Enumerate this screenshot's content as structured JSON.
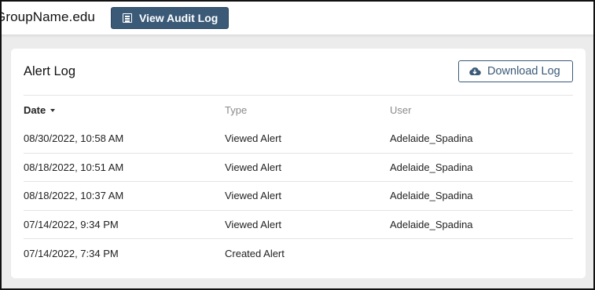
{
  "header": {
    "org_name": "GroupName.edu",
    "audit_button_label": "View Audit Log",
    "audit_button_icon": "list-icon"
  },
  "card": {
    "title": "Alert Log",
    "download_label": "Download Log",
    "download_icon": "cloud-download-icon"
  },
  "table": {
    "columns": [
      "Date",
      "Type",
      "User"
    ],
    "sort_column": "Date",
    "sort_direction": "descending",
    "rows": [
      {
        "date": "08/30/2022, 10:58 AM",
        "type": "Viewed Alert",
        "user": "Adelaide_Spadina"
      },
      {
        "date": "08/18/2022, 10:51 AM",
        "type": "Viewed Alert",
        "user": "Adelaide_Spadina"
      },
      {
        "date": "08/18/2022, 10:37 AM",
        "type": "Viewed Alert",
        "user": "Adelaide_Spadina"
      },
      {
        "date": "07/14/2022, 9:34 PM",
        "type": "Viewed Alert",
        "user": "Adelaide_Spadina"
      },
      {
        "date": "07/14/2022, 7:34 PM",
        "type": "Created Alert",
        "user": ""
      }
    ]
  },
  "colors": {
    "primary": "#3b5a78",
    "background": "#ececec",
    "card": "#ffffff",
    "muted_text": "#8a8a8a"
  }
}
